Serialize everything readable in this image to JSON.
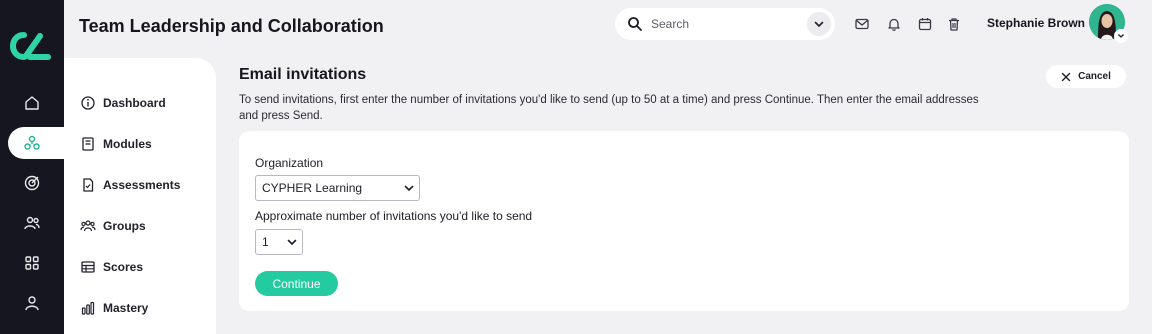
{
  "app": {
    "title": "Team Leadership and Collaboration"
  },
  "search": {
    "placeholder": "Search"
  },
  "user": {
    "name": "Stephanie Brown"
  },
  "header_icons": [
    "mail-icon",
    "bell-icon",
    "calendar-icon",
    "trash-icon"
  ],
  "rail": {
    "items": [
      {
        "icon": "home-icon"
      },
      {
        "icon": "network-icon",
        "active": true
      },
      {
        "icon": "target-icon"
      },
      {
        "icon": "people-icon"
      },
      {
        "icon": "grid-icon"
      },
      {
        "icon": "user-icon"
      }
    ]
  },
  "sidebar": {
    "items": [
      {
        "label": "Dashboard",
        "icon": "info-icon"
      },
      {
        "label": "Modules",
        "icon": "book-icon"
      },
      {
        "label": "Assessments",
        "icon": "document-icon"
      },
      {
        "label": "Groups",
        "icon": "groups-icon"
      },
      {
        "label": "Scores",
        "icon": "table-icon"
      },
      {
        "label": "Mastery",
        "icon": "bar-chart-icon"
      }
    ]
  },
  "main": {
    "title": "Email invitations",
    "instructions": "To send invitations, first enter the number of invitations you'd like to send (up to 50 at a time) and press Continue. Then enter the email addresses and press Send.",
    "cancel_label": "Cancel",
    "organization_label": "Organization",
    "organization_value": "CYPHER Learning",
    "count_label": "Approximate number of invitations you'd like to send",
    "count_value": "1",
    "continue_label": "Continue"
  },
  "colors": {
    "rail_bg": "#161620",
    "accent": "#25cba0",
    "page_bg": "#f1f1f4"
  }
}
